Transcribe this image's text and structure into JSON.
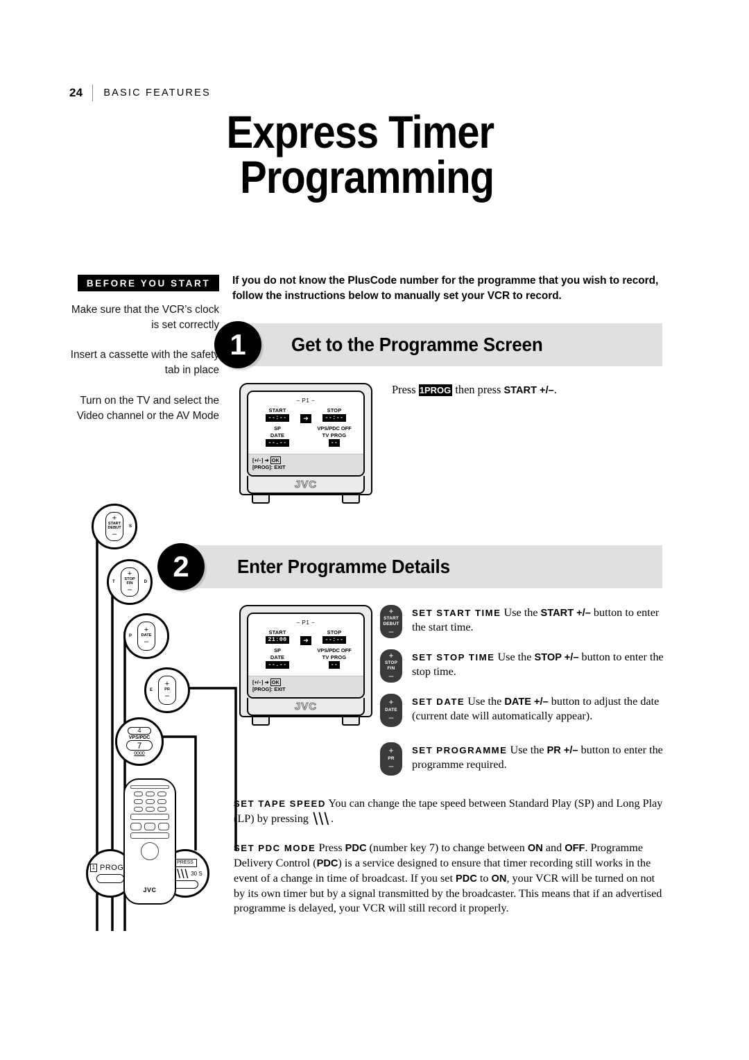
{
  "header": {
    "page_number": "24",
    "section": "BASIC FEATURES"
  },
  "title": {
    "line1": "Express Timer",
    "line2": "Programming"
  },
  "sidebar": {
    "badge": "BEFORE YOU START",
    "notes": [
      "Make sure that the VCR’s clock is set correctly",
      "Insert a cassette with the safety tab in place",
      "Turn on the TV and select the Video channel or the AV Mode"
    ]
  },
  "intro": "If you do not know the PlusCode number for the programme that you wish to record, follow the instructions below to manually set your VCR to record.",
  "steps": [
    {
      "number": "1",
      "title": "Get to the Programme Screen"
    },
    {
      "number": "2",
      "title": "Enter Programme Details"
    }
  ],
  "step1": {
    "instruction_pre": "Press ",
    "instruction_key": "1PROG",
    "instruction_mid": " then press ",
    "instruction_bold": "START +/–",
    "instruction_end": "."
  },
  "tv_screen_1": {
    "programme_label": "– P1 –",
    "start_label": "START",
    "start_value": "--:--",
    "arrow": "➜",
    "stop_label": "STOP",
    "stop_value": "--:--",
    "speed_label": "SP",
    "vps_label": "VPS/PDC OFF",
    "date_label": "DATE",
    "date_value": "--.--",
    "tvprog_label": "TV PROG",
    "tvprog_value": "--",
    "footer_line1_pre": "[+/–] ➜ ",
    "footer_line1_ok": "OK",
    "footer_line2": "[PROG]: EXIT",
    "brand": "JVC"
  },
  "tv_screen_2": {
    "programme_label": "– P1 –",
    "start_label": "START",
    "start_value": "21:00",
    "arrow": "➜",
    "stop_label": "STOP",
    "stop_value": "--:--",
    "speed_label": "SP",
    "vps_label": "VPS/PDC OFF",
    "date_label": "DATE",
    "date_value": "--.--",
    "tvprog_label": "TV PROG",
    "tvprog_value": "--",
    "footer_line1_pre": "[+/–] ➜ ",
    "footer_line1_ok": "OK",
    "footer_line2": "[PROG]: EXIT",
    "brand": "JVC"
  },
  "step2_items": [
    {
      "button": {
        "plus": "+",
        "name_line1": "START",
        "name_line2": "DEBUT",
        "minus": "–"
      },
      "caption": "SET START TIME",
      "text_pre": "Use the ",
      "bold": "START +/–",
      "text_post": " button to enter the start time."
    },
    {
      "button": {
        "plus": "+",
        "name_line1": "STOP",
        "name_line2": "FIN",
        "minus": "–"
      },
      "caption": "SET STOP TIME",
      "text_pre": "Use the ",
      "bold": "STOP +/–",
      "text_post": " button to enter the stop time."
    },
    {
      "button": {
        "plus": "+",
        "name_line1": "DATE",
        "name_line2": "",
        "minus": "–"
      },
      "caption": "SET DATE",
      "text_pre": "Use the ",
      "bold": "DATE +/–",
      "text_post": " button to adjust the date (current date will automatically appear)."
    },
    {
      "button": {
        "plus": "+",
        "name_line1": "PR",
        "name_line2": "",
        "minus": "–"
      },
      "caption": "SET PROGRAMME",
      "text_pre": "Use the ",
      "bold": "PR +/–",
      "text_post": " button to enter the programme required."
    }
  ],
  "tape_speed": {
    "caption": "SET TAPE SPEED",
    "text_pre": "You can change the tape speed between Standard Play (SP) and Long Play (LP) by pressing ",
    "glyph": "SP/LP",
    "text_post": " ."
  },
  "pdc": {
    "caption": "SET PDC MODE",
    "t1": "Press ",
    "b1": "PDC",
    "t2": " (number key 7) to change between ",
    "b2": "ON",
    "t3": " and ",
    "b3": "OFF",
    "t4": ". Programme Delivery Control (",
    "b4": "PDC",
    "t5": ") is a service designed to ensure that timer recording still works in the event of a change in time of broadcast. If you set ",
    "b5": "PDC",
    "t6": " to ",
    "b6": "ON",
    "t7": ", your VCR will be turned on not by its own timer but by a signal transmitted by the broadcaster. This means that if an advertised programme is delayed, your VCR will still record it properly."
  },
  "callouts": [
    {
      "plus": "+",
      "name_line1": "START",
      "name_line2": "DEBUT",
      "minus": "–",
      "side_left": "",
      "side_right": "S"
    },
    {
      "plus": "+",
      "name_line1": "STOP",
      "name_line2": "FIN",
      "minus": "–",
      "side_left": "T",
      "side_right": "D"
    },
    {
      "plus": "+",
      "name_line1": "DATE",
      "name_line2": "",
      "minus": "–",
      "side_left": "P",
      "side_right": ""
    },
    {
      "plus": "+",
      "name_line1": "PR",
      "name_line2": "",
      "minus": "–",
      "side_left": "E",
      "side_right": ""
    }
  ],
  "callout_vps": {
    "top_key": "4",
    "label": "VPS/PDC",
    "key": "7",
    "bottom": "0000"
  },
  "callout_prog": {
    "key_box": "1",
    "label": "PROG",
    "right_partial": "S"
  },
  "callout_speed": {
    "press_label": "PRESS",
    "glyph": "SP/LP",
    "right_label": "30 S"
  },
  "remote": {
    "brand": "JVC"
  }
}
